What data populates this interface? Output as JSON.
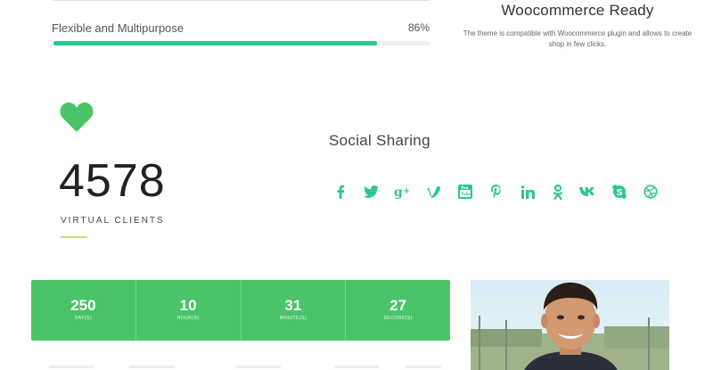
{
  "progress": {
    "label": "Flexible and Multipurpose",
    "value_text": "86%",
    "value": 0.86
  },
  "feature": {
    "title": "Woocommerce Ready",
    "text": "The theme is compatible with Woocommerce plugin and allows to create shop in few clicks."
  },
  "counter": {
    "icon": "heart-icon",
    "number": "4578",
    "label": "VIRTUAL CLIENTS"
  },
  "social": {
    "title": "Social Sharing",
    "icons": [
      "facebook-icon",
      "twitter-icon",
      "google-plus-icon",
      "vimeo-icon",
      "youtube-icon",
      "pinterest-icon",
      "linkedin-icon",
      "odnoklassniki-icon",
      "vk-icon",
      "skype-icon",
      "dribbble-icon"
    ]
  },
  "countdown": {
    "cells": [
      {
        "value": "250",
        "unit": "DAY(S)"
      },
      {
        "value": "10",
        "unit": "HOUR(S)"
      },
      {
        "value": "31",
        "unit": "MINUTE(S)"
      },
      {
        "value": "27",
        "unit": "SECOND(S)"
      }
    ]
  },
  "colors": {
    "accent": "#2dc78b",
    "countdown_bg": "#4ac468",
    "heart": "#4ac468",
    "underline": "#c4d98b"
  }
}
